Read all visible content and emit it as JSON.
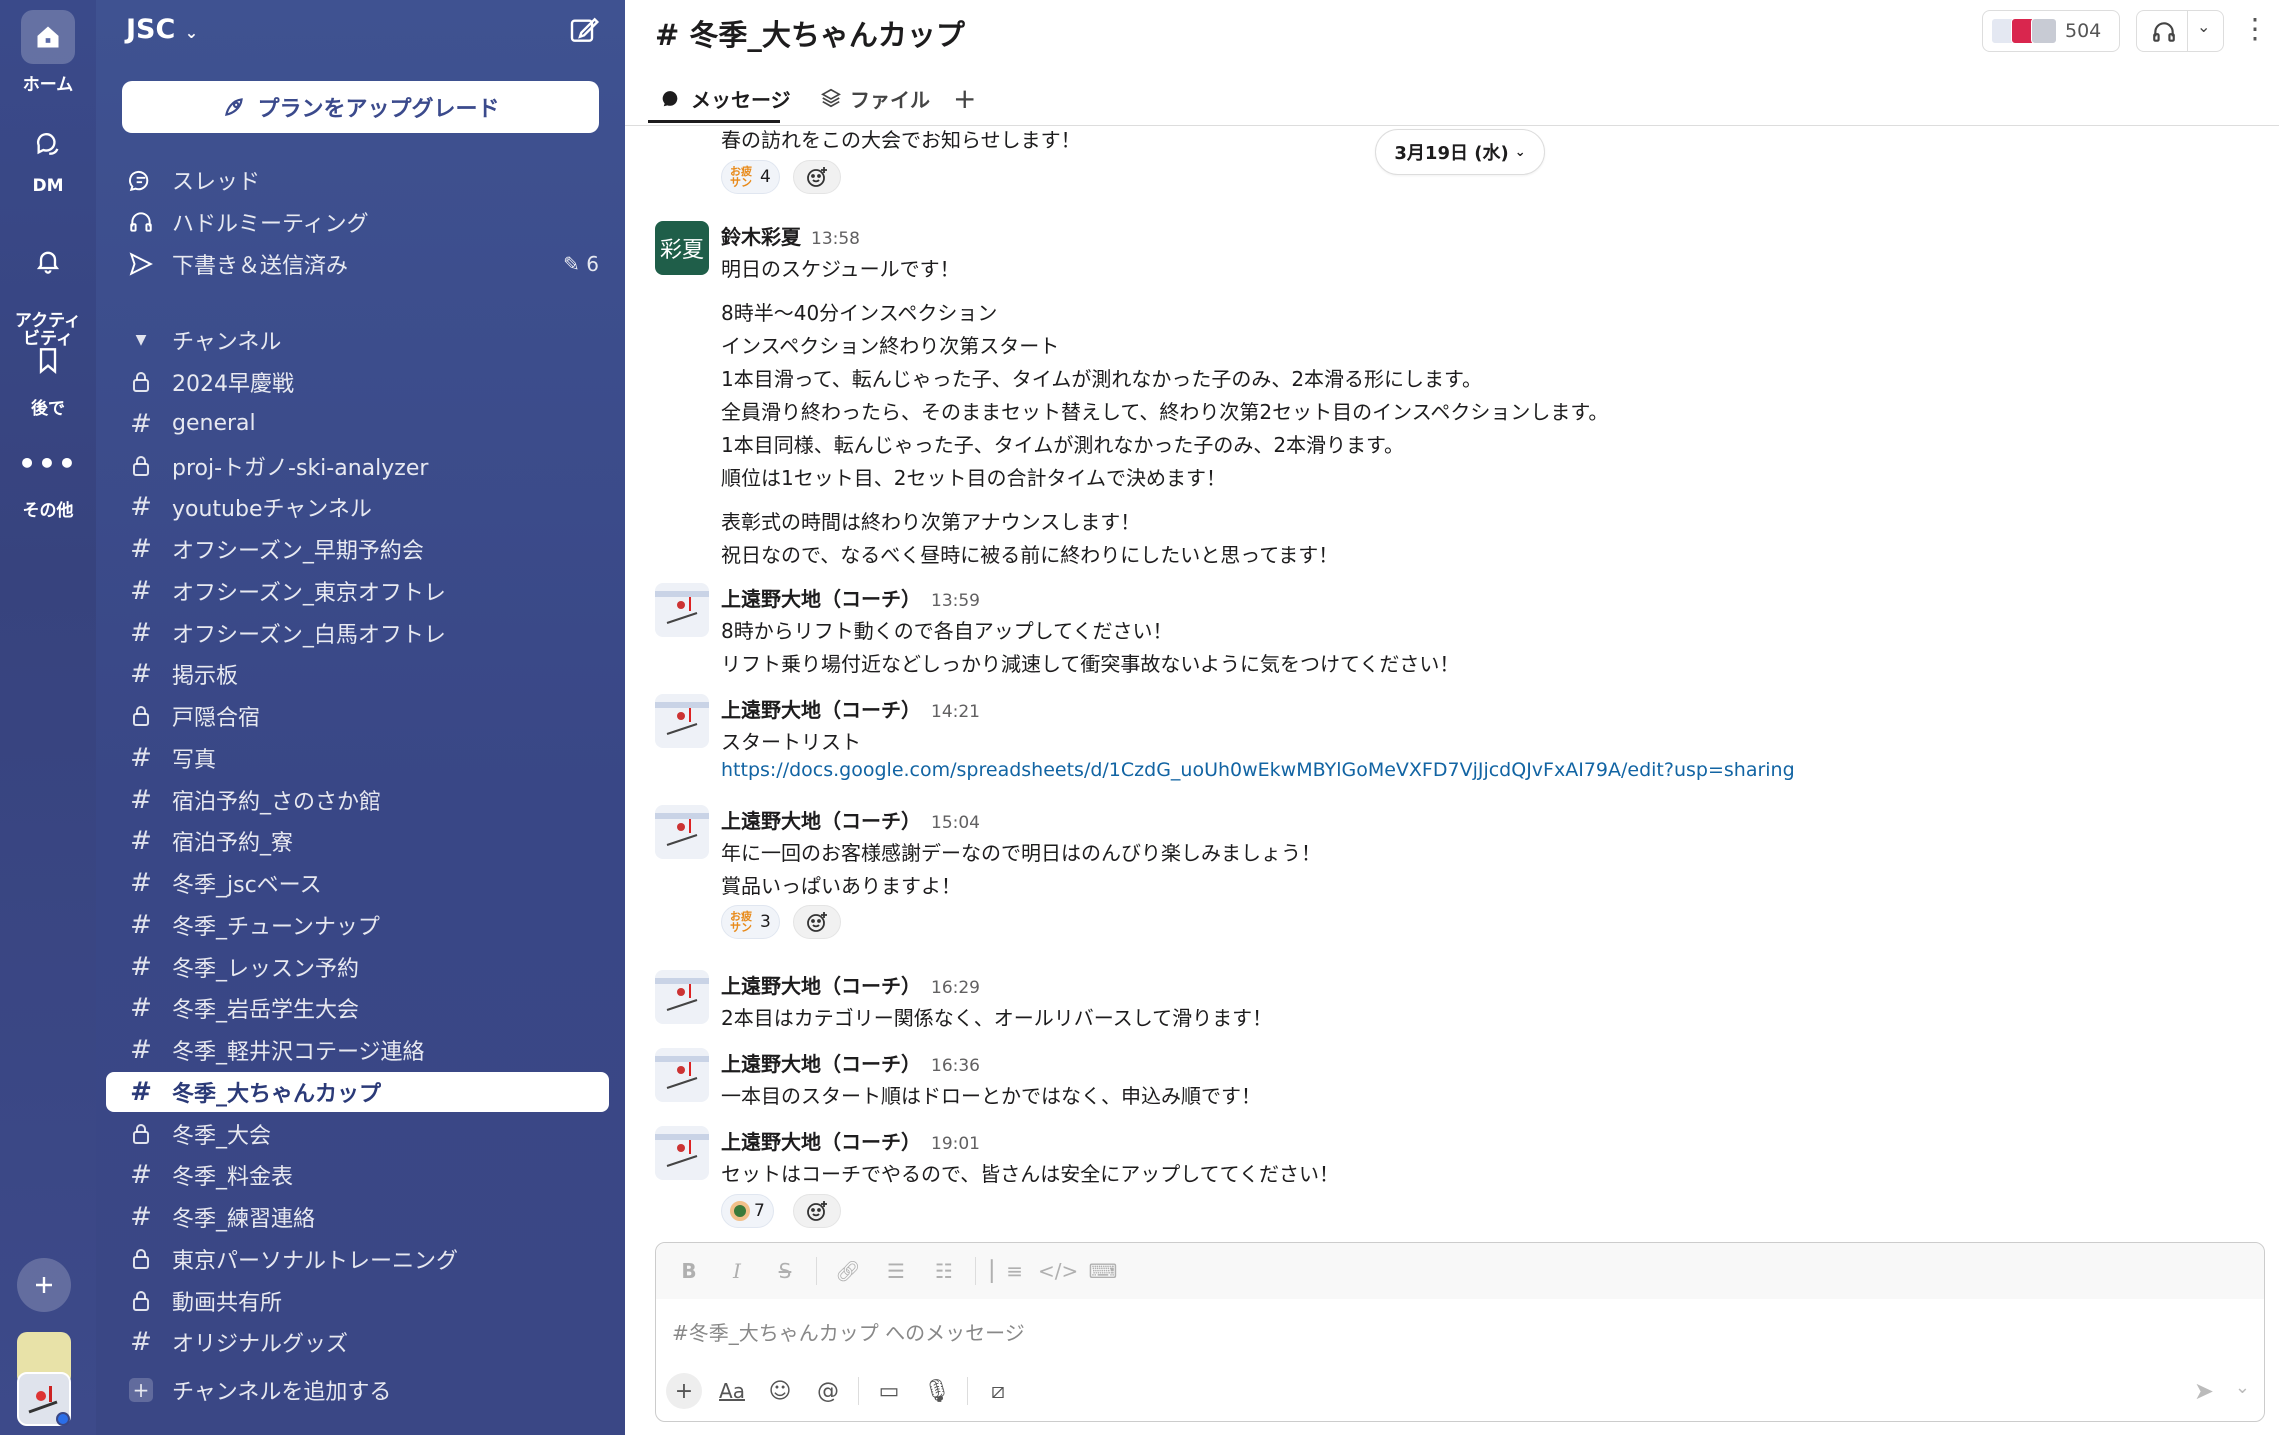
{
  "rail": {
    "items": [
      {
        "label": "ホーム"
      },
      {
        "label": "DM"
      },
      {
        "label": "アクティ\nビティ"
      },
      {
        "label": "後で"
      },
      {
        "label": "その他"
      }
    ]
  },
  "sidebar": {
    "workspace": "JSC",
    "upgrade_label": "プランをアップグレード",
    "top_items": [
      {
        "label": "スレッド",
        "icon": "threads-icon"
      },
      {
        "label": "ハドルミーティング",
        "icon": "headphones-icon"
      },
      {
        "label": "下書き＆送信済み",
        "icon": "send-icon",
        "count": "6"
      }
    ],
    "channels_header": "チャンネル",
    "channels": [
      {
        "label": "2024早慶戦",
        "private": true
      },
      {
        "label": "general",
        "private": false
      },
      {
        "label": "proj-トガノ-ski-analyzer",
        "private": true
      },
      {
        "label": "youtubeチャンネル",
        "private": false
      },
      {
        "label": "オフシーズン_早期予約会",
        "private": false
      },
      {
        "label": "オフシーズン_東京オフトレ",
        "private": false
      },
      {
        "label": "オフシーズン_白馬オフトレ",
        "private": false
      },
      {
        "label": "掲示板",
        "private": false
      },
      {
        "label": "戸隠合宿",
        "private": true
      },
      {
        "label": "写真",
        "private": false
      },
      {
        "label": "宿泊予約_さのさか館",
        "private": false
      },
      {
        "label": "宿泊予約_寮",
        "private": false
      },
      {
        "label": "冬季_jscベース",
        "private": false
      },
      {
        "label": "冬季_チューンナップ",
        "private": false
      },
      {
        "label": "冬季_レッスン予約",
        "private": false
      },
      {
        "label": "冬季_岩岳学生大会",
        "private": false
      },
      {
        "label": "冬季_軽井沢コテージ連絡",
        "private": false
      },
      {
        "label": "冬季_大ちゃんカップ",
        "private": false,
        "selected": true
      },
      {
        "label": "冬季_大会",
        "private": true
      },
      {
        "label": "冬季_料金表",
        "private": false
      },
      {
        "label": "冬季_練習連絡",
        "private": false
      },
      {
        "label": "東京パーソナルトレーニング",
        "private": true
      },
      {
        "label": "動画共有所",
        "private": true
      },
      {
        "label": "オリジナルグッズ",
        "private": false
      }
    ],
    "add_channel": "チャンネルを追加する"
  },
  "header": {
    "title": "# 冬季_大ちゃんカップ",
    "member_count": "504",
    "tabs": [
      {
        "label": "メッセージ"
      },
      {
        "label": "ファイル"
      }
    ]
  },
  "date_pill": "3月19日 (水)",
  "messages": {
    "m0": {
      "lines": [
        "春の訪れをこの大会でお知らせします！"
      ],
      "reaction": {
        "emoji": "お疲れサン",
        "count": "4"
      }
    },
    "m1": {
      "author": "鈴木彩夏",
      "time": "13:58",
      "avatar_text": "彩夏",
      "lines": [
        "明日のスケジュールです！",
        "8時半〜40分インスペクション",
        "インスペクション終わり次第スタート",
        "1本目滑って、転んじゃった子、タイムが測れなかった子のみ、2本滑る形にします。",
        "全員滑り終わったら、そのままセット替えして、終わり次第2セット目のインスペクションします。",
        "1本目同様、転んじゃった子、タイムが測れなかった子のみ、2本滑ります。",
        "順位は1セット目、2セット目の合計タイムで決めます！",
        "表彰式の時間は終わり次第アナウンスします！",
        "祝日なので、なるべく昼時に被る前に終わりにしたいと思ってます！"
      ]
    },
    "m2": {
      "author": "上遠野大地（コーチ）",
      "time": "13:59",
      "lines": [
        "8時からリフト動くので各自アップしてください！",
        "リフト乗り場付近などしっかり減速して衝突事故ないように気をつけてください！"
      ]
    },
    "m3": {
      "author": "上遠野大地（コーチ）",
      "time": "14:21",
      "lines": [
        "スタートリスト"
      ],
      "link": "https://docs.google.com/spreadsheets/d/1CzdG_uoUh0wEkwMBYlGoMeVXFD7VjJjcdQJvFxAI79A/edit?usp=sharing"
    },
    "m4": {
      "author": "上遠野大地（コーチ）",
      "time": "15:04",
      "lines": [
        "年に一回のお客様感謝デーなので明日はのんびり楽しみましょう！",
        "賞品いっぱいありますよ！"
      ],
      "reaction": {
        "emoji": "お疲れサン",
        "count": "3"
      }
    },
    "m5": {
      "author": "上遠野大地（コーチ）",
      "time": "16:29",
      "lines": [
        "2本目はカテゴリー関係なく、オールリバースして滑ります！"
      ]
    },
    "m6": {
      "author": "上遠野大地（コーチ）",
      "time": "16:36",
      "lines": [
        "一本目のスタート順はドローとかではなく、申込み順です！"
      ]
    },
    "m7": {
      "author": "上遠野大地（コーチ）",
      "time": "19:01",
      "lines": [
        "セットはコーチでやるので、皆さんは安全にアップしててください！"
      ],
      "reaction": {
        "emoji": "person-emoji",
        "count": "7"
      }
    }
  },
  "composer": {
    "placeholder": "#冬季_大ちゃんカップ へのメッセージ",
    "format_label": "Aa"
  },
  "colors": {
    "sidebar": "#3a4785",
    "link": "#1264a3",
    "selected_text": "#2b3a78"
  }
}
